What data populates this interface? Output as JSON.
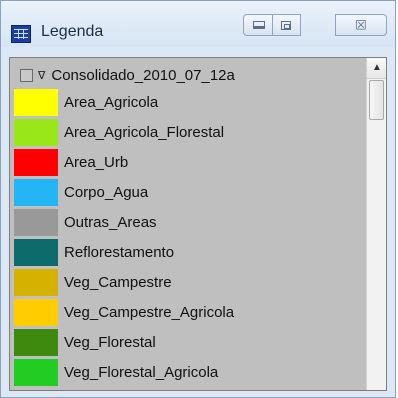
{
  "window": {
    "title": "Legenda",
    "app_icon": "map-legend-icon",
    "controls": {
      "minimize_icon": "minimize-icon",
      "maximize_icon": "maximize-icon",
      "close_glyph": "☒"
    }
  },
  "tree": {
    "root_label": "Consolidado_2010_07_12a",
    "expand_glyph": "∇",
    "items": [
      {
        "label": "Area_Agricola",
        "color": "#ffff00"
      },
      {
        "label": "Area_Agricola_Florestal",
        "color": "#99e619"
      },
      {
        "label": "Area_Urb",
        "color": "#ff0000"
      },
      {
        "label": "Corpo_Agua",
        "color": "#23b5f5"
      },
      {
        "label": "Outras_Areas",
        "color": "#999999"
      },
      {
        "label": "Reflorestamento",
        "color": "#0d6b6b"
      },
      {
        "label": "Veg_Campestre",
        "color": "#d6b200"
      },
      {
        "label": "Veg_Campestre_Agricola",
        "color": "#ffcc00"
      },
      {
        "label": "Veg_Florestal",
        "color": "#3d8a0f"
      },
      {
        "label": "Veg_Florestal_Agricola",
        "color": "#22cc22"
      }
    ]
  },
  "scrollbar": {
    "up_glyph": "▲",
    "position_fraction": 0.0
  }
}
